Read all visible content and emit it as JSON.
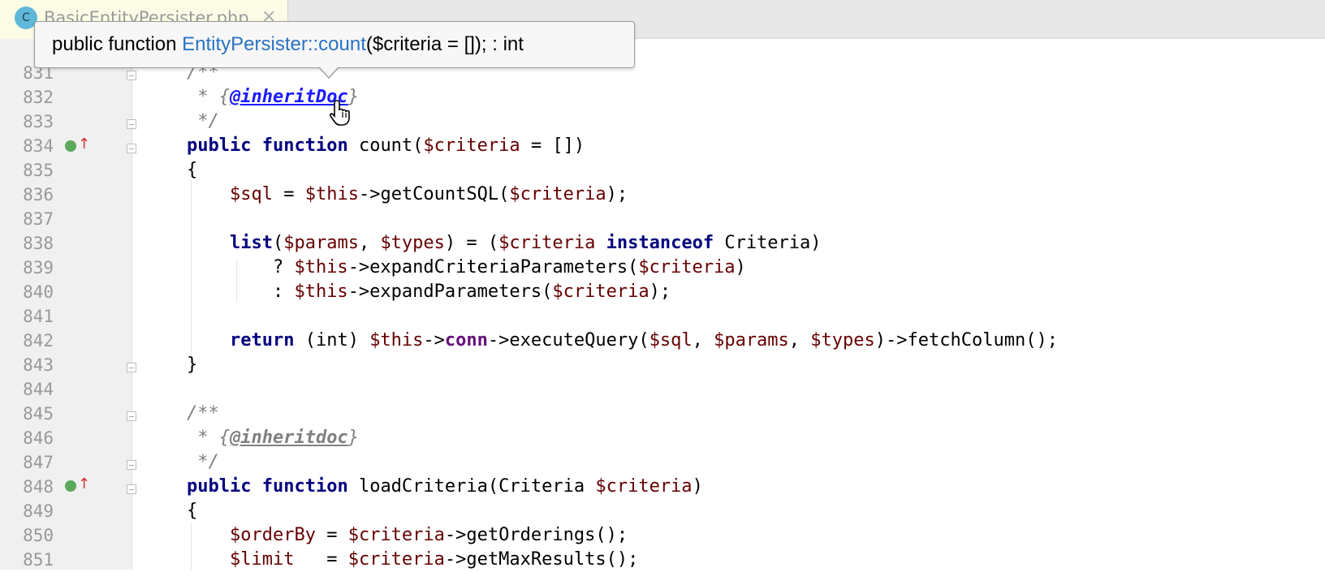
{
  "tab": {
    "icon_letter": "C",
    "label": "BasicEntityPersister.php",
    "close_glyph": "×"
  },
  "tooltip": {
    "prefix": "public function ",
    "link": "EntityPersister::count",
    "suffix": "($criteria = []); : int"
  },
  "lines": [
    {
      "n": "831",
      "text": "/**"
    },
    {
      "n": "832",
      "text": " * {@inheritDoc}"
    },
    {
      "n": "833",
      "text": " */"
    },
    {
      "n": "834",
      "text": "public function count($criteria = [])"
    },
    {
      "n": "835",
      "text": "{"
    },
    {
      "n": "836",
      "text": "    $sql = $this->getCountSQL($criteria);"
    },
    {
      "n": "837",
      "text": ""
    },
    {
      "n": "838",
      "text": "    list($params, $types) = ($criteria instanceof Criteria)"
    },
    {
      "n": "839",
      "text": "        ? $this->expandCriteriaParameters($criteria)"
    },
    {
      "n": "840",
      "text": "        : $this->expandParameters($criteria);"
    },
    {
      "n": "841",
      "text": ""
    },
    {
      "n": "842",
      "text": "    return (int) $this->conn->executeQuery($sql, $params, $types)->fetchColumn();"
    },
    {
      "n": "843",
      "text": "}"
    },
    {
      "n": "844",
      "text": ""
    },
    {
      "n": "845",
      "text": "/**"
    },
    {
      "n": "846",
      "text": " * {@inheritdoc}"
    },
    {
      "n": "847",
      "text": " */"
    },
    {
      "n": "848",
      "text": "public function loadCriteria(Criteria $criteria)"
    },
    {
      "n": "849",
      "text": "{"
    },
    {
      "n": "850",
      "text": "    $orderBy = $criteria->getOrderings();"
    },
    {
      "n": "851",
      "text": "    $limit   = $criteria->getMaxResults();"
    }
  ],
  "colors": {
    "keyword": "#000080",
    "variable": "#660000",
    "field": "#660e7a",
    "comment": "#808080",
    "doc_link": "#1a1aff",
    "tooltip_link": "#2a73c4"
  },
  "icons": {
    "implements": "implements-method-icon",
    "overrides": "override-arrow-icon",
    "cursor": "hand-pointer-icon"
  }
}
